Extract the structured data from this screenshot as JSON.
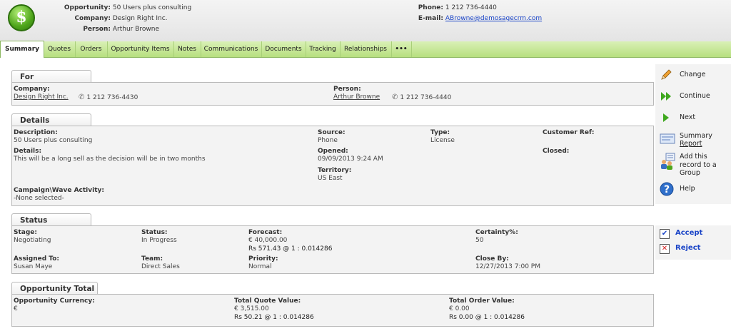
{
  "header": {
    "opportunity_label": "Opportunity:",
    "opportunity_value": "50 Users plus consulting",
    "company_label": "Company:",
    "company_value": "Design Right Inc.",
    "person_label": "Person:",
    "person_value": "Arthur Browne",
    "phone_label": "Phone:",
    "phone_value": "1 212 736-4440",
    "email_label": "E-mail:",
    "email_value": "ABrowne@demosagecrm.com"
  },
  "tabs": [
    "Summary",
    "Quotes",
    "Orders",
    "Opportunity Items",
    "Notes",
    "Communications",
    "Documents",
    "Tracking",
    "Relationships",
    "•••"
  ],
  "for_panel": {
    "title": "For",
    "company_label": "Company:",
    "company_value": "Design Right Inc.",
    "company_phone": "1 212 736-4430",
    "person_label": "Person:",
    "person_value": "Arthur Browne",
    "person_phone": "1 212 736-4440"
  },
  "details_panel": {
    "title": "Details",
    "description_label": "Description:",
    "description_value": "50 Users plus consulting",
    "details_label": "Details:",
    "details_value": "This will be a long sell as the decision will be in two months",
    "campaign_label": "Campaign\\Wave Activity:",
    "campaign_value": "-None selected-",
    "source_label": "Source:",
    "source_value": "Phone",
    "opened_label": "Opened:",
    "opened_value": "09/09/2013 9:24 AM",
    "territory_label": "Territory:",
    "territory_value": "US East",
    "type_label": "Type:",
    "type_value": "License",
    "customer_ref_label": "Customer Ref:",
    "closed_label": "Closed:"
  },
  "status_panel": {
    "title": "Status",
    "stage_label": "Stage:",
    "stage_value": "Negotiating",
    "status_label": "Status:",
    "status_value": "In Progress",
    "forecast_label": "Forecast:",
    "forecast_value": "€ 40,000.00",
    "forecast_conv": "Rs 571.43 @ 1 : 0.014286",
    "certainty_label": "Certainty%:",
    "certainty_value": "50",
    "assigned_label": "Assigned To:",
    "assigned_value": "Susan Maye",
    "team_label": "Team:",
    "team_value": "Direct Sales",
    "priority_label": "Priority:",
    "priority_value": "Normal",
    "closeby_label": "Close By:",
    "closeby_value": "12/27/2013 7:00 PM"
  },
  "total_panel": {
    "title": "Opportunity Total",
    "currency_label": "Opportunity Currency:",
    "currency_value": "€",
    "quote_label": "Total Quote Value:",
    "quote_value": "€ 3,515.00",
    "quote_conv": "Rs 50.21 @ 1 : 0.014286",
    "order_label": "Total Order Value:",
    "order_value": "€ 0.00",
    "order_conv": "Rs 0.00 @ 1 : 0.014286"
  },
  "actions": {
    "change": "Change",
    "continue": "Continue",
    "next": "Next",
    "summary_report_1": "Summary",
    "summary_report_2": "Report",
    "add_group_1": "Add this",
    "add_group_2": "record to a",
    "add_group_3": "Group",
    "help": "Help",
    "accept": "Accept",
    "reject": "Reject"
  },
  "colors": {
    "tab_bar": "#b7df7f",
    "link": "#1a44c7",
    "accent_green": "#4ea51a"
  }
}
